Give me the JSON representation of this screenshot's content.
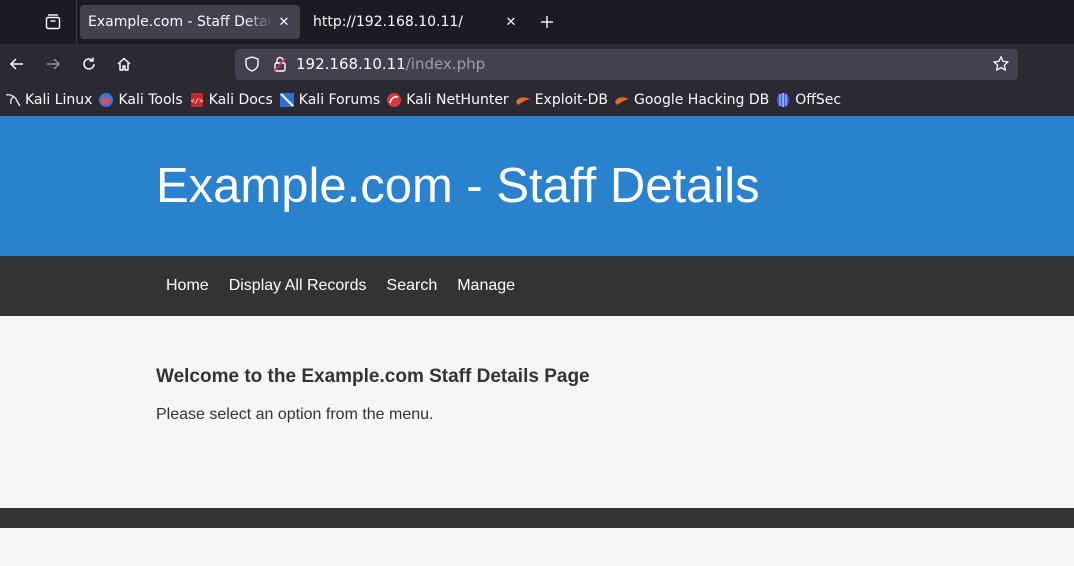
{
  "browser": {
    "tabs": [
      {
        "title": "Example.com - Staff Details - ",
        "active": true
      },
      {
        "title": "http://192.168.10.11/",
        "active": false
      }
    ],
    "url_host": "192.168.10.11",
    "url_path": "/index.php",
    "bookmarks": [
      {
        "label": "Kali Linux",
        "icon": "kali-dragon-icon"
      },
      {
        "label": "Kali Tools",
        "icon": "kali-tools-icon"
      },
      {
        "label": "Kali Docs",
        "icon": "kali-docs-icon"
      },
      {
        "label": "Kali Forums",
        "icon": "kali-forums-icon"
      },
      {
        "label": "Kali NetHunter",
        "icon": "nethunter-icon"
      },
      {
        "label": "Exploit-DB",
        "icon": "exploit-db-icon"
      },
      {
        "label": "Google Hacking DB",
        "icon": "ghdb-icon"
      },
      {
        "label": "OffSec",
        "icon": "offsec-icon"
      }
    ]
  },
  "site": {
    "title": "Example.com - Staff Details",
    "nav": [
      "Home",
      "Display All Records",
      "Search",
      "Manage"
    ],
    "heading": "Welcome to the Example.com Staff Details Page",
    "message": "Please select an option from the menu."
  },
  "colors": {
    "header_bg": "#2a82cc",
    "nav_bg": "#333333",
    "page_bg": "#f6f6f6",
    "browser_chrome": "#2b2a33"
  }
}
